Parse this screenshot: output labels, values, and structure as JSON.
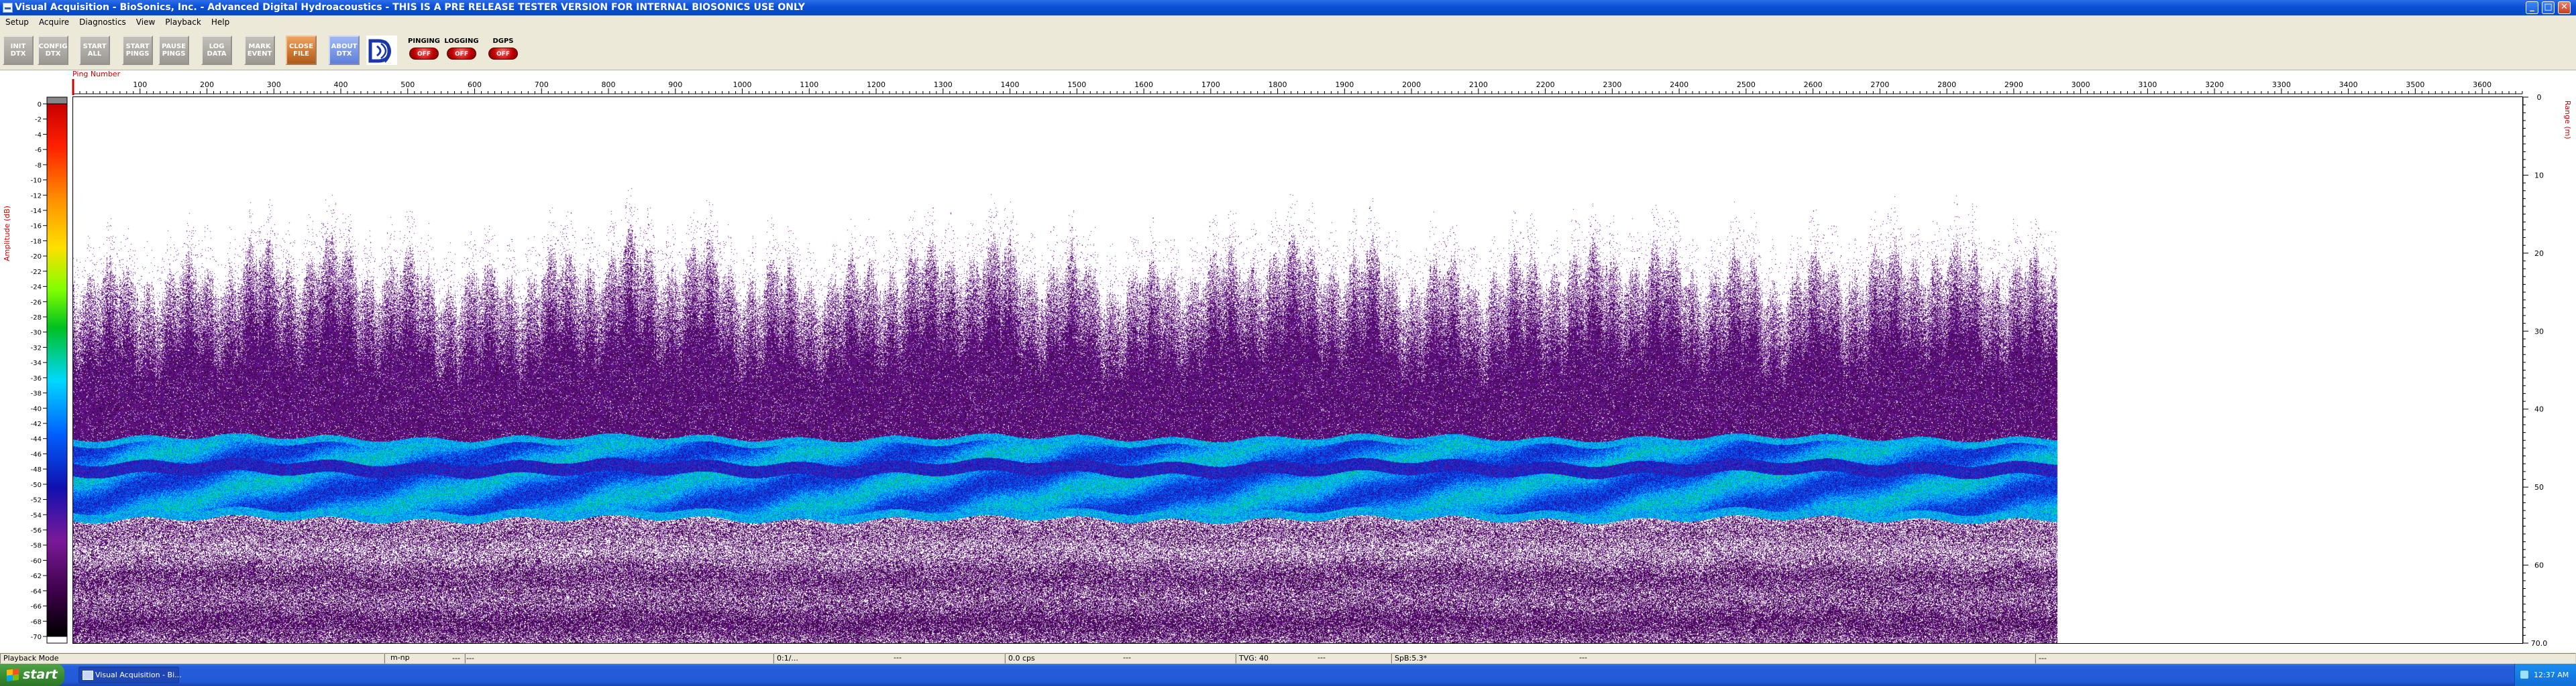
{
  "window": {
    "title": "Visual Acquisition  -  BioSonics, Inc.  -  Advanced Digital Hydroacoustics  -  THIS IS A PRE RELEASE TESTER VERSION FOR INTERNAL BIOSONICS USE ONLY",
    "min_glyph": "_",
    "max_glyph": "□",
    "close_glyph": "✕"
  },
  "menu": [
    "Setup",
    "Acquire",
    "Diagnostics",
    "View",
    "Playback",
    "Help"
  ],
  "toolbar": {
    "buttons": [
      {
        "label": "INIT\nDTX",
        "style": "gray"
      },
      {
        "label": "CONFIG\nDTX",
        "style": "gray"
      },
      {
        "label": "START\nALL",
        "style": "gray"
      },
      {
        "label": "START\nPINGS",
        "style": "gray"
      },
      {
        "label": "PAUSE\nPINGS",
        "style": "gray"
      },
      {
        "label": "LOG\nDATA",
        "style": "gray"
      },
      {
        "label": "MARK\nEVENT",
        "style": "gray"
      },
      {
        "label": "CLOSE\nFILE",
        "style": "orange"
      },
      {
        "label": "ABOUT\nDTX",
        "style": "blue"
      }
    ],
    "logo_icon": "biosonics-logo-icon",
    "indicators": [
      {
        "label": "PINGING",
        "state": "OFF"
      },
      {
        "label": "LOGGING",
        "state": "OFF"
      },
      {
        "label": "DGPS",
        "state": "OFF"
      }
    ]
  },
  "plot": {
    "ping_axis_label": "Ping Number",
    "ping_ticks": [
      100,
      200,
      300,
      400,
      500,
      600,
      700,
      800,
      900,
      1000,
      1100,
      1200,
      1300,
      1400,
      1500,
      1600,
      1700,
      1800,
      1900,
      2000,
      2100,
      2200,
      2300,
      2400,
      2500,
      2600,
      2700,
      2800,
      2900,
      3000,
      3100,
      3200,
      3300,
      3400,
      3500,
      3600
    ],
    "ping_range": [
      0,
      3660
    ],
    "data_pings": 2965,
    "amplitude_label": "Amplitude (dB)",
    "amplitude_ticks": [
      0,
      -2,
      -4,
      -6,
      -8,
      -10,
      -12,
      -14,
      -16,
      -18,
      -20,
      -22,
      -24,
      -26,
      -28,
      -30,
      -32,
      -34,
      -36,
      -38,
      -40,
      -42,
      -44,
      -46,
      -48,
      -50,
      -52,
      -54,
      -56,
      -58,
      -60,
      -62,
      -64,
      -66,
      -68,
      -70
    ],
    "range_label": "Range (m)",
    "range_ticks": [
      "0",
      "10",
      "20",
      "30",
      "40",
      "50",
      "60",
      "70.0"
    ],
    "range_max": 70,
    "accent_color": "#d00000"
  },
  "status": {
    "mode": "Playback Mode",
    "c1": "---",
    "units": "m-np",
    "c2": "---",
    "time": "0:1/...",
    "c3": "---",
    "rate": "0.0 cps",
    "c4": "---",
    "tvg": "TVG: 40",
    "c5": "---",
    "spb": "SpB:5.3*",
    "c6": "---",
    "c7": "---"
  },
  "taskbar": {
    "start_label": "start",
    "task_label": "Visual Acquisition  -  Bi...",
    "clock": "12:37 AM"
  }
}
